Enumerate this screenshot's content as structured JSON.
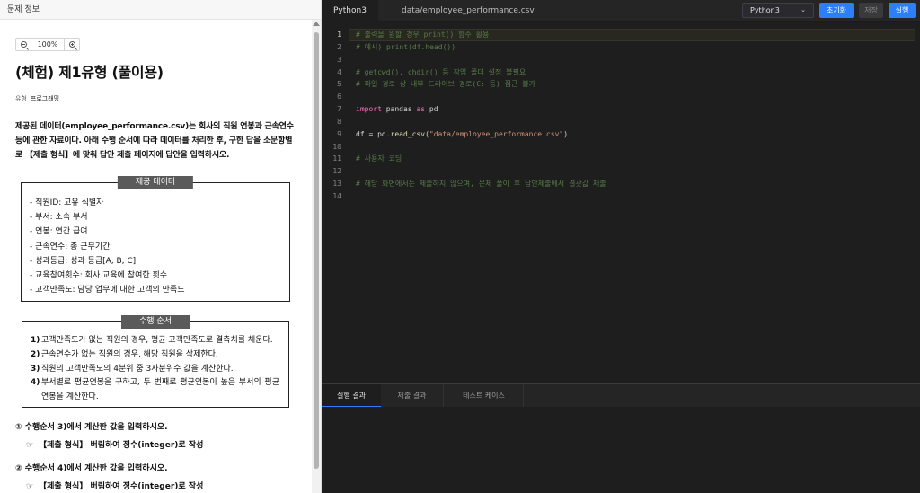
{
  "left": {
    "header": "문제 정보",
    "zoom": "100%",
    "title": "(체험) 제1유형 (풀이용)",
    "type_label": "유형",
    "type_value": "프로그래밍",
    "intro": "제공된 데이터(employee_performance.csv)는 회사의 직원 연봉과 근속연수 등에 관한 자료이다. 아래 수행 순서에 따라 데이터를 처리한 후, 구한 답을 소문항별로 【제출 형식】에 맞춰 답안 제출 페이지에 답안을 입력하시오.",
    "data_box": {
      "title": "제공 데이터",
      "items": [
        "- 직원ID: 고유 식별자",
        "- 부서: 소속 부서",
        "- 연봉: 연간 급여",
        "- 근속연수: 총 근무기간",
        "- 성과등급: 성과 등급[A, B, C]",
        "- 교육참여횟수: 회사 교육에 참여한 횟수",
        "- 고객만족도: 담당 업무에 대한 고객의 만족도"
      ]
    },
    "order_box": {
      "title": "수행 순서",
      "steps": [
        {
          "n": "1)",
          "text": "고객만족도가 없는 직원의 경우, 평균 고객만족도로 결측치를 채운다."
        },
        {
          "n": "2)",
          "text": "근속연수가 없는 직원의 경우, 해당 직원을 삭제한다."
        },
        {
          "n": "3)",
          "text": "직원의 고객만족도의 4분위 중 3사분위수 값을 계산한다."
        },
        {
          "n": "4)",
          "text": "부서별로 평균연봉을 구하고, 두 번째로 평균연봉이 높은 부서의 평균연봉을 계산한다."
        }
      ]
    },
    "q1": "① 수행순서 3)에서 계산한 값을 입력하시오.",
    "q1_format": "【제출 형식】 버림하여 정수(integer)로 작성",
    "q2": "② 수행순서 4)에서 계산한 값을 입력하시오.",
    "q2_format": "【제출 형식】 버림하여 정수(integer)로 작성",
    "hand_glyph": "☞"
  },
  "right": {
    "tabs": [
      "Python3",
      "data/employee_performance.csv"
    ],
    "lang_select": "Python3",
    "buttons": {
      "reset": "초기화",
      "save": "저장",
      "run": "실행"
    },
    "line_numbers": [
      "1",
      "2",
      "3",
      "4",
      "5",
      "6",
      "7",
      "8",
      "9",
      "10",
      "11",
      "12",
      "13",
      "14"
    ],
    "code": {
      "l1": "# 출력을 원할 경우 print() 함수 활용",
      "l2": "# 예시) print(df.head())",
      "l4": "# getcwd(), chdir() 등 작업 폴더 설정 불필요",
      "l5": "# 파일 경로 상 내부 드라이브 경로(C: 등) 접근 불가",
      "l7_kw1": "import",
      "l7_mod": " pandas ",
      "l7_kw2": "as",
      "l7_alias": " pd",
      "l9_pre": "df = pd.",
      "l9_fn": "read_csv",
      "l9_open": "(",
      "l9_str": "\"data/employee_performance.csv\"",
      "l9_close": ")",
      "l11": "# 사용자 코딩",
      "l13": "# 해당 화면에서는 제출하지 않으며, 문제 풀이 후 답안제출에서 결괏값 제출"
    },
    "result_tabs": [
      "실행 결과",
      "제출 결과",
      "테스트 케이스"
    ]
  },
  "colors": {
    "accent": "#2d7ff9",
    "editor_bg": "#1e1e1e",
    "keyword": "#ff6fc0",
    "string": "#ce9178",
    "function": "#dcdcaa",
    "comment": "#6a9955"
  }
}
